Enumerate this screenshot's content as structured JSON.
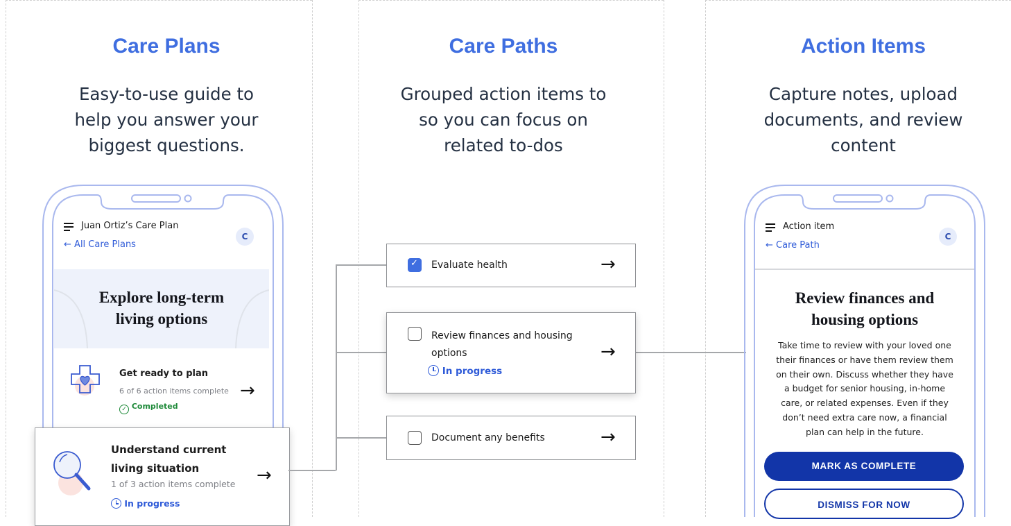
{
  "columns": [
    {
      "title": "Care Plans",
      "description_lines": [
        "Easy-to-use guide to",
        "help you answer your",
        "biggest questions."
      ]
    },
    {
      "title": "Care Paths",
      "description_lines": [
        "Grouped action items to",
        "so you can focus on",
        "related to-dos"
      ]
    },
    {
      "title": "Action Items",
      "description_lines": [
        "Capture notes, upload",
        "documents, and review",
        "content"
      ]
    }
  ],
  "left_phone": {
    "header_title": "Juan Ortiz’s Care Plan",
    "back_link": "All Care Plans",
    "avatar": "C",
    "hero_title_lines": [
      "Explore long-term",
      "living options"
    ],
    "item1": {
      "title": "Get ready to plan",
      "subtitle": "6 of 6 action items complete",
      "status": "Completed"
    }
  },
  "overlay_card": {
    "title_lines": [
      "Understand current",
      "living situation"
    ],
    "subtitle": "1 of 3 action items complete",
    "status": "In progress"
  },
  "care_path_items": [
    {
      "label_lines": [
        "Evaluate health"
      ],
      "checked": true,
      "status": ""
    },
    {
      "label_lines": [
        "Review finances and housing",
        "options"
      ],
      "checked": false,
      "status": "In progress"
    },
    {
      "label_lines": [
        "Document any benefits"
      ],
      "checked": false,
      "status": ""
    }
  ],
  "right_phone": {
    "header_title": "Action item",
    "back_link": "Care Path",
    "avatar": "C",
    "title_lines": [
      "Review finances and",
      "housing options"
    ],
    "body_lines": [
      "Take time to review with your loved one",
      "their finances or have them review them",
      "on their own. Discuss whether they have",
      "a budget for senior housing, in-home",
      "care, or related expenses. Even if they",
      "don’t need extra care now, a financial",
      "plan can help in the future."
    ],
    "primary_button": "MARK AS COMPLETE",
    "secondary_button": "DISMISS FOR NOW"
  },
  "colors": {
    "accent": "#3f6ee0",
    "button_dark": "#1235a8",
    "completed": "#1f8a3a",
    "phone_frame": "#a9b8ee",
    "hero_bg": "#eef2fb"
  },
  "icons": [
    "menu-icon",
    "arrow-left-icon",
    "arrow-right-icon",
    "clock-icon",
    "check-circle-icon",
    "heart-cross-icon",
    "magnifier-icon",
    "checkbox-icon"
  ]
}
